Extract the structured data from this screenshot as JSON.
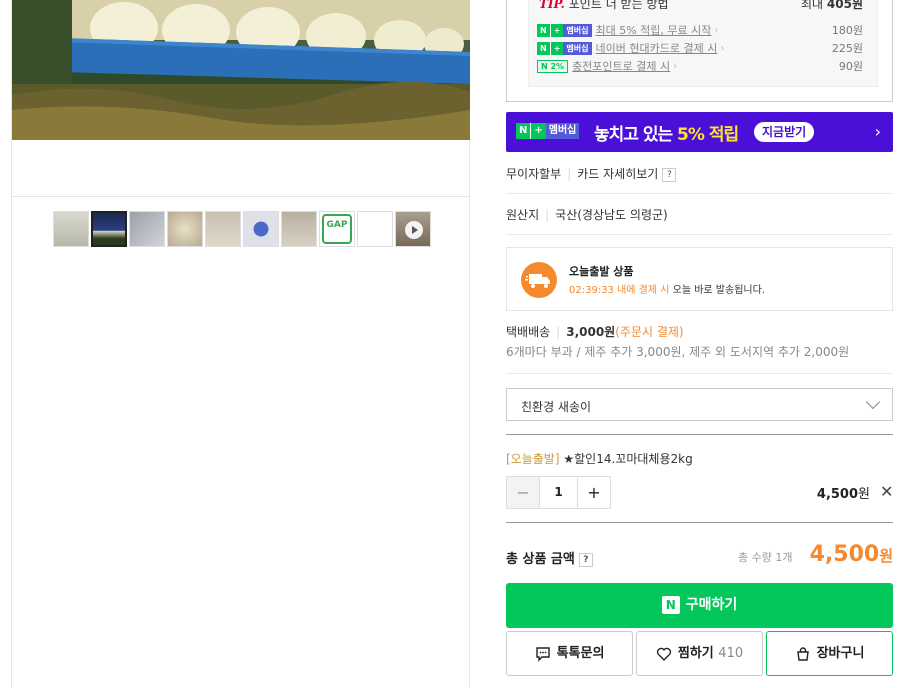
{
  "tip": {
    "word": "TIP.",
    "title": "포인트 더 받는 방법",
    "max_prefix": "최대",
    "max_amount": "405원",
    "badge_n": "N",
    "badge_plus": "+",
    "badge_membership": "멤버십",
    "badge_pct": "N 2%",
    "rows": [
      {
        "label": "최대 5% 적립, 무료 시작",
        "amount": "180원"
      },
      {
        "label": "네이버 현대카드로 결제 시",
        "amount": "225원"
      },
      {
        "label": "충전포인트로 결제 시",
        "amount": "90원"
      }
    ]
  },
  "banner": {
    "badge_n": "N",
    "badge_plus": "+",
    "badge_membership": "멤버십",
    "text_prefix": "놓치고 있는",
    "text_highlight": "5% 적립",
    "pill": "지금받기",
    "arrow": "›"
  },
  "card_info": {
    "installment": "무이자할부",
    "card_detail": "카드 자세히보기",
    "help": "?"
  },
  "origin": {
    "label": "원산지",
    "value": "국산(경상남도 의령군)"
  },
  "shipping": {
    "title": "오늘출발 상품",
    "time": "02:39:33 내에 결제 시",
    "desc": "오늘 바로 발송됩니다."
  },
  "delivery": {
    "method": "택배배송",
    "fee": "3,000원",
    "paid": "(주문시 결제)",
    "sub": "6개마다 부과 / 제주 추가 3,000원, 제주 외 도서지역 추가 2,000원"
  },
  "option_select": {
    "value": "친환경 새송이"
  },
  "selected_option": {
    "tag": "[오늘출발]",
    "name": "★할인14.꼬마대체용2kg",
    "minus": "−",
    "plus": "+",
    "quantity": "1",
    "price": "4,500",
    "won": "원",
    "remove": "✕"
  },
  "total": {
    "label": "총 상품 금액",
    "help": "?",
    "qty_text": "총 수량 1개",
    "price": "4,500",
    "won": "원"
  },
  "buttons": {
    "buy_logo": "N",
    "buy": "구매하기",
    "talk": "톡톡문의",
    "wish": "찜하기",
    "wish_count": "410",
    "cart": "장바구니"
  },
  "thumbnails": {
    "gap_label": "GAP"
  },
  "colors": {
    "naver_green": "#03c75a",
    "accent_orange": "#f5892e",
    "banner_purple": "#4a10d8",
    "tip_red": "#e0002a"
  }
}
